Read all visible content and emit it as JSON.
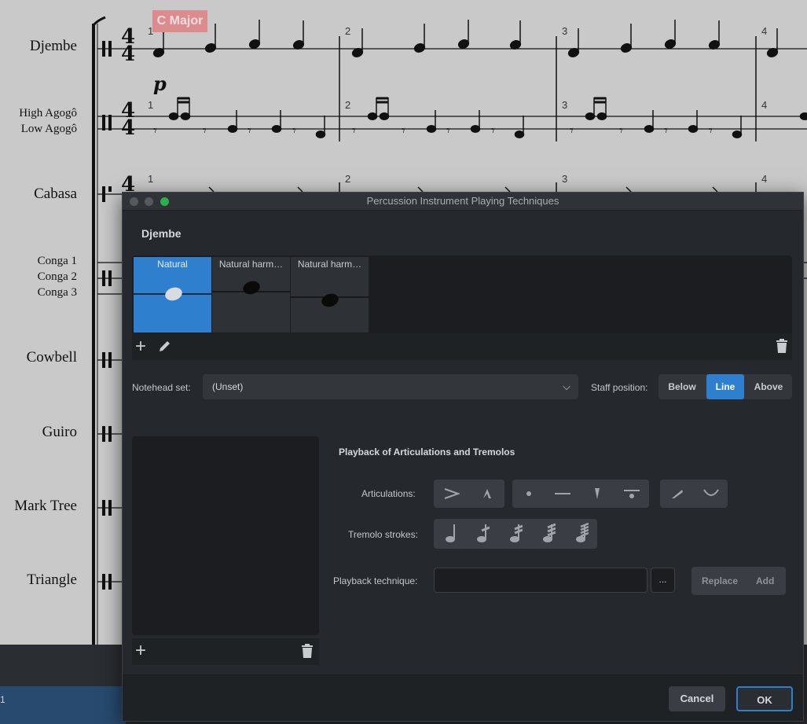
{
  "score": {
    "key_signature": "C Major",
    "instruments": [
      "Djembe",
      "High Agogô",
      "Low Agogô",
      "Cabasa",
      "Conga 1",
      "Conga 2",
      "Conga 3",
      "Cowbell",
      "Guiro",
      "Mark Tree",
      "Triangle"
    ],
    "bar_numbers": [
      "1",
      "2",
      "3",
      "4"
    ],
    "time_signature_top": "4",
    "time_signature_bottom": "4",
    "dynamic": "p"
  },
  "status_bar": {
    "text": "1"
  },
  "dialog": {
    "title": "Percussion Instrument Playing Techniques",
    "instrument_name": "Djembe",
    "techniques": [
      {
        "label": "Natural",
        "selected": true
      },
      {
        "label": "Natural harm…",
        "selected": false
      },
      {
        "label": "Natural harm…",
        "selected": false
      }
    ],
    "notehead_set_label": "Notehead set:",
    "notehead_set_value": "(Unset)",
    "staff_position_label": "Staff position:",
    "staff_position_options": [
      "Below",
      "Line",
      "Above"
    ],
    "staff_position_selected": "Line",
    "playback_section_title": "Playback of Articulations and Tremolos",
    "articulations_label": "Articulations:",
    "tremolo_label": "Tremolo strokes:",
    "playback_technique_label": "Playback technique:",
    "playback_technique_value": "",
    "dots_label": "...",
    "replace_label": "Replace",
    "add_label": "Add",
    "cancel_label": "Cancel",
    "ok_label": "OK"
  },
  "colors": {
    "accent": "#2f7fcf",
    "dialog_bg": "#25282c",
    "score_bg": "#c9c9c9",
    "key_badge": "#dc8c8c"
  }
}
